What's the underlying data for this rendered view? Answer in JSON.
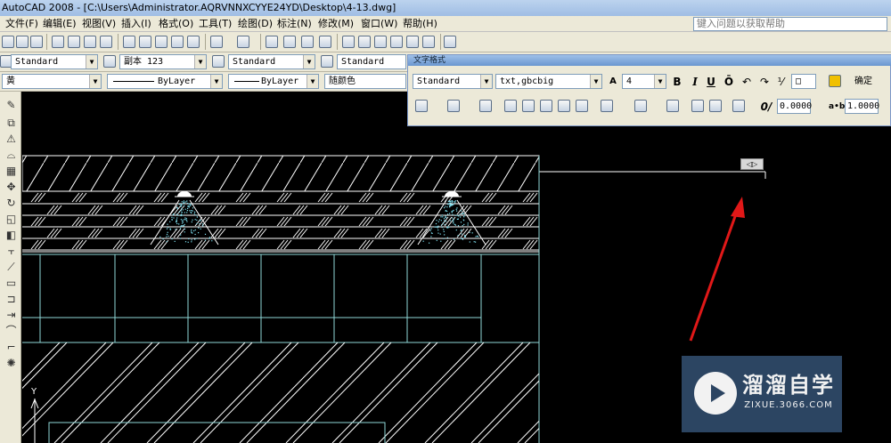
{
  "window": {
    "title": "AutoCAD 2008 - [C:\\Users\\Administrator.AQRVNNXCYYE24YD\\Desktop\\4-13.dwg]"
  },
  "menubar": {
    "items": [
      "文件(F)",
      "编辑(E)",
      "视图(V)",
      "插入(I)",
      "格式(O)",
      "工具(T)",
      "绘图(D)",
      "标注(N)",
      "修改(M)",
      "窗口(W)",
      "帮助(H)"
    ],
    "help_placeholder": "键入问题以获取帮助"
  },
  "styles_toolbar": {
    "text_style": "Standard",
    "dim_style": "副本 123",
    "table_style": "Standard",
    "mleader_style": "Standard"
  },
  "layers_toolbar": {
    "layer": "黄",
    "linetype": "ByLayer",
    "lineweight": "ByLayer",
    "color": "随颜色"
  },
  "text_formatting": {
    "title": "文字格式",
    "style": "Standard",
    "font": "txt,gbcbig",
    "height": "4",
    "bold": "B",
    "italic": "I",
    "underline": "U",
    "overline": "Ō",
    "ok_label": "确定",
    "oblique": "0.0000",
    "tracking": "1.0000"
  },
  "canvas": {
    "ucs_y_label": "Y",
    "text_editor_grip": "◁▷"
  },
  "watermark": {
    "title": "溜溜自学",
    "subtitle": "ZIXUE.3066.COM"
  },
  "colors": {
    "cad_background": "#000000",
    "hatch_line": "#ffffff",
    "structure_line": "#8fd8d8",
    "spray_dots": "#7fe0f0",
    "arrow": "#e01818",
    "watermark_bg": "#2f4968"
  }
}
